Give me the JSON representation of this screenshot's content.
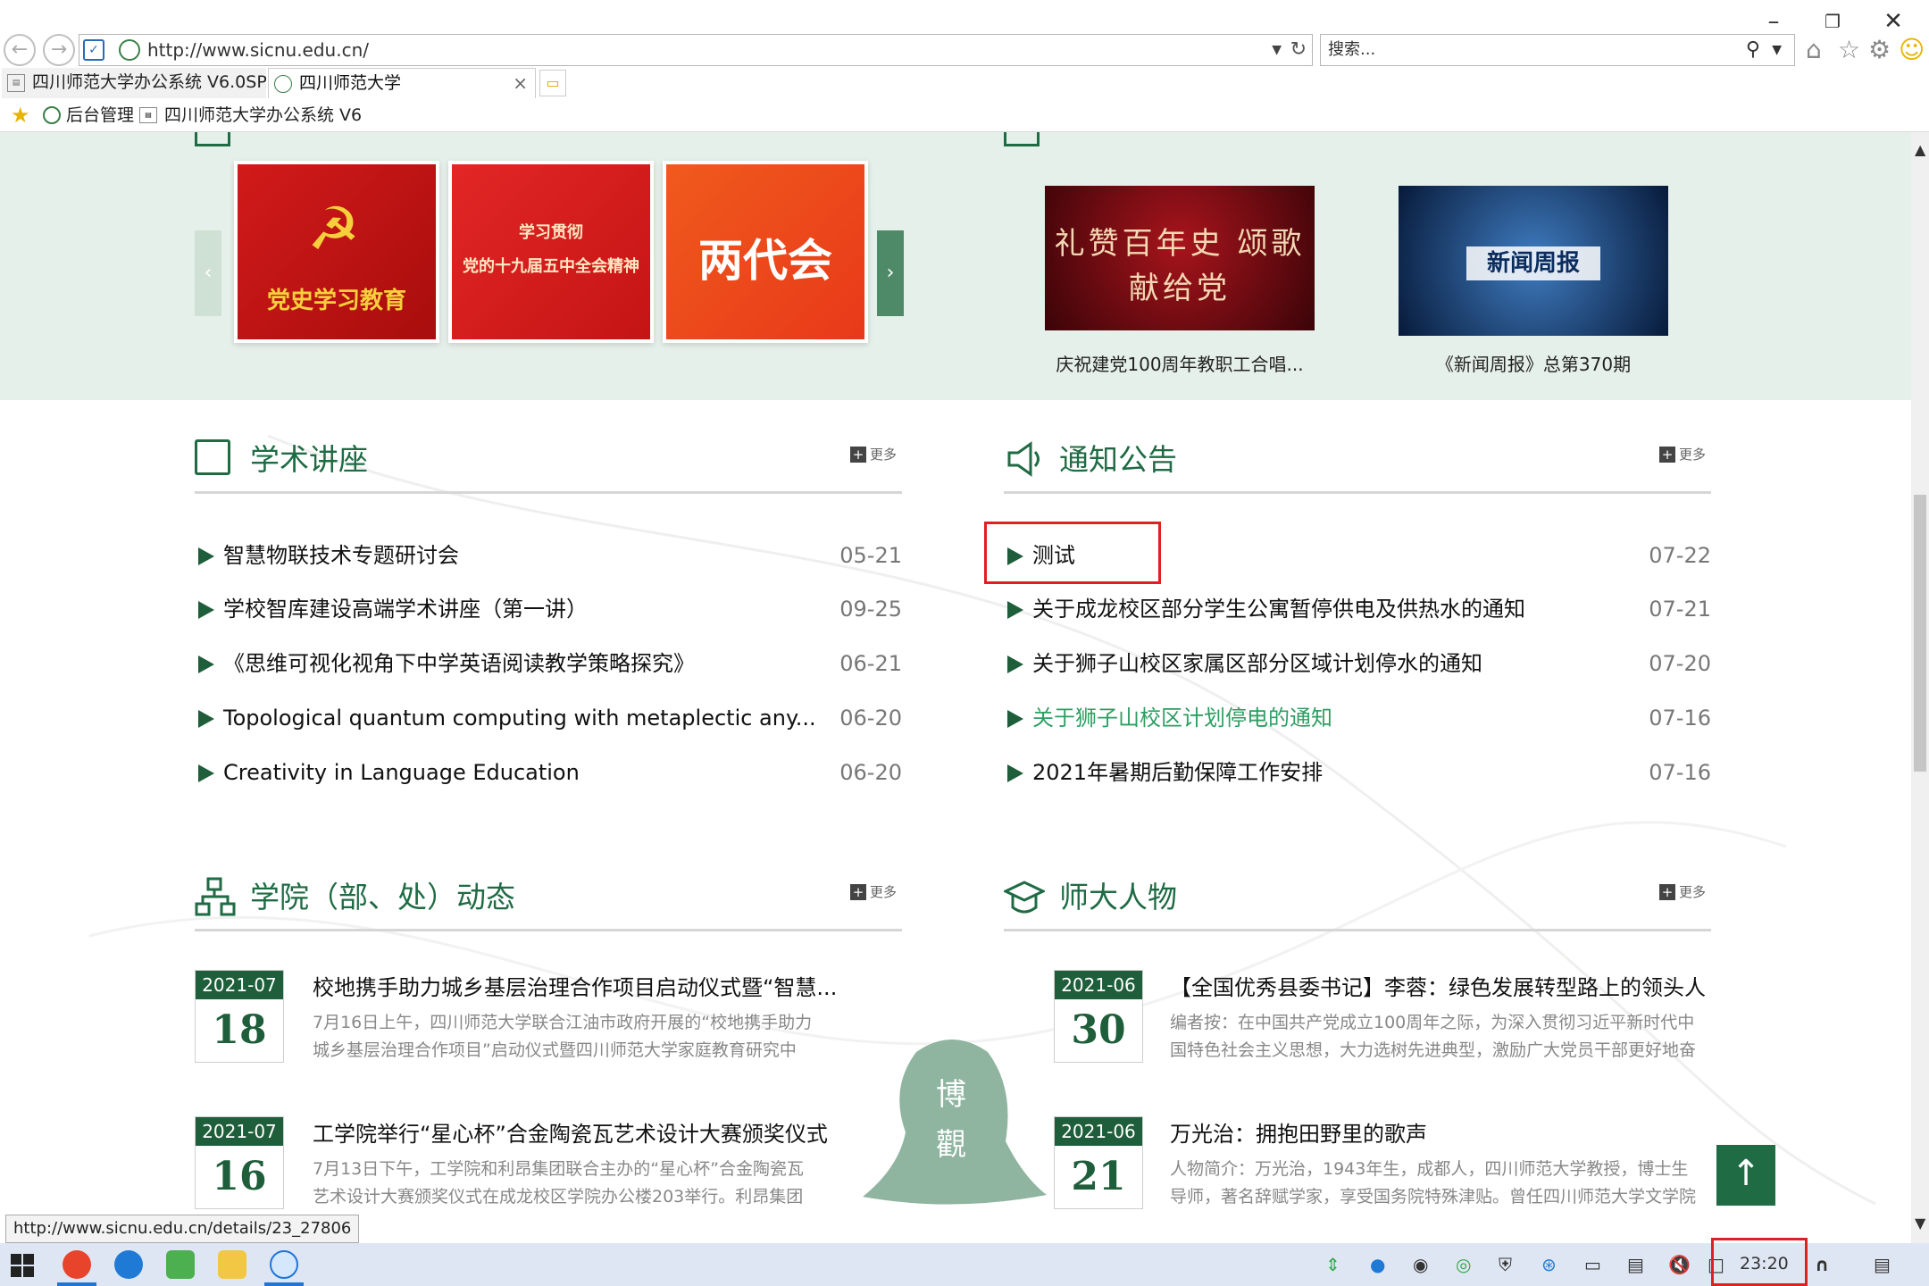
{
  "browser": {
    "address": "http://www.sicnu.edu.cn/",
    "search_placeholder": "搜索...",
    "tabs": [
      {
        "label": "四川师范大学办公系统 V6.0SP..."
      },
      {
        "label": "四川师范大学"
      }
    ],
    "favorites": [
      {
        "label": "后台管理"
      },
      {
        "label": "四川师范大学办公系统 V6"
      }
    ],
    "status_url": "http://www.sicnu.edu.cn/details/23_27806"
  },
  "top": {
    "banners": [
      {
        "lines": [
          "党史学习教育"
        ]
      },
      {
        "lines": [
          "学习贯彻",
          "党的十九届五中全会精神"
        ]
      },
      {
        "lines": [
          "两代会"
        ]
      }
    ],
    "videos": [
      {
        "caption": "庆祝建党100周年教职工合唱...",
        "overlay": "礼赞百年史 颂歌献给党"
      },
      {
        "caption": "《新闻周报》总第370期",
        "overlay": "新闻周报"
      }
    ]
  },
  "lectures": {
    "title": "学术讲座",
    "more": "更多",
    "items": [
      {
        "text": "智慧物联技术专题研讨会",
        "date": "05-21"
      },
      {
        "text": "学校智库建设高端学术讲座（第一讲）",
        "date": "09-25"
      },
      {
        "text": "《思维可视化视角下中学英语阅读教学策略探究》",
        "date": "06-21"
      },
      {
        "text": "Topological quantum computing with metaplectic any...",
        "date": "06-20"
      },
      {
        "text": "Creativity in Language Education",
        "date": "06-20"
      }
    ]
  },
  "notices": {
    "title": "通知公告",
    "more": "更多",
    "items": [
      {
        "text": "测试",
        "date": "07-22"
      },
      {
        "text": "关于成龙校区部分学生公寓暂停供电及供热水的通知",
        "date": "07-21"
      },
      {
        "text": "关于狮子山校区家属区部分区域计划停水的通知",
        "date": "07-20"
      },
      {
        "text": "关于狮子山校区计划停电的通知",
        "date": "07-16"
      },
      {
        "text": "2021年暑期后勤保障工作安排",
        "date": "07-16"
      }
    ]
  },
  "college_news": {
    "title": "学院（部、处）动态",
    "more": "更多",
    "items": [
      {
        "ym": "2021-07",
        "day": "18",
        "title": "校地携手助力城乡基层治理合作项目启动仪式暨“智慧...",
        "desc": "7月16日上午，四川师范大学联合江油市政府开展的“校地携手助力城乡基层治理合作项目”启动仪式暨四川师范大学家庭教育研究中心“智"
      },
      {
        "ym": "2021-07",
        "day": "16",
        "title": "工学院举行“星心杯”合金陶瓷瓦艺术设计大赛颁奖仪式",
        "desc": "7月13日下午，工学院和利昂集团联合主办的“星心杯”合金陶瓷瓦艺术设计大赛颁奖仪式在成龙校区学院办公楼203举行。利昂集团副总经"
      }
    ]
  },
  "people": {
    "title": "师大人物",
    "more": "更多",
    "items": [
      {
        "ym": "2021-06",
        "day": "30",
        "title": "【全国优秀县委书记】李蓉：绿色发展转型路上的领头人",
        "desc": "编者按：在中国共产党成立100周年之际，为深入贯彻习近平新时代中国特色社会主义思想，大力选树先进典型，激励广大党员干部更好地奋"
      },
      {
        "ym": "2021-06",
        "day": "21",
        "title": "万光治：拥抱田野里的歌声",
        "desc": "人物简介：万光治，1943年生，成都人，四川师范大学教授，博士生导师，著名辞赋学家，享受国务院特殊津贴。曾任四川师范大学文学院"
      }
    ]
  },
  "deco": {
    "stone_text": "博觀"
  },
  "taskbar": {
    "time": "23:20"
  },
  "colors": {
    "accent": "#1f6b44",
    "band": "#e6f0ea",
    "highlight_link": "#2e9e62",
    "annotation": "#e02020"
  }
}
